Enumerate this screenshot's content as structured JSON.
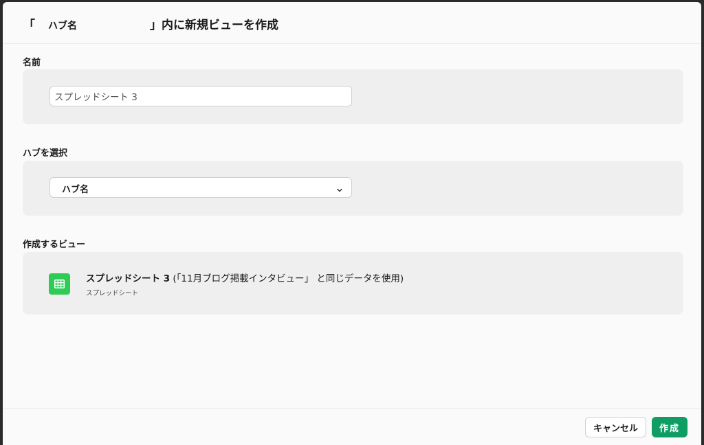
{
  "dialog": {
    "title_prefix": "「",
    "title_hub_name": "ハブ名",
    "title_suffix": "」内に新規ビューを作成"
  },
  "name_section": {
    "label": "名前",
    "input_value": "スプレッドシート 3"
  },
  "hub_section": {
    "label": "ハブを選択",
    "selected": "ハブ名"
  },
  "view_section": {
    "label": "作成するビュー",
    "view_name": "スプレッドシート 3",
    "view_note": "(「11月ブログ掲載インタビュー」 と同じデータを使用)",
    "view_type": "スプレッドシート",
    "icon": "grid-table-icon",
    "icon_color": "#2ecc55"
  },
  "footer": {
    "cancel_label": "キャンセル",
    "create_label": "作成",
    "create_color": "#0f9d63"
  }
}
